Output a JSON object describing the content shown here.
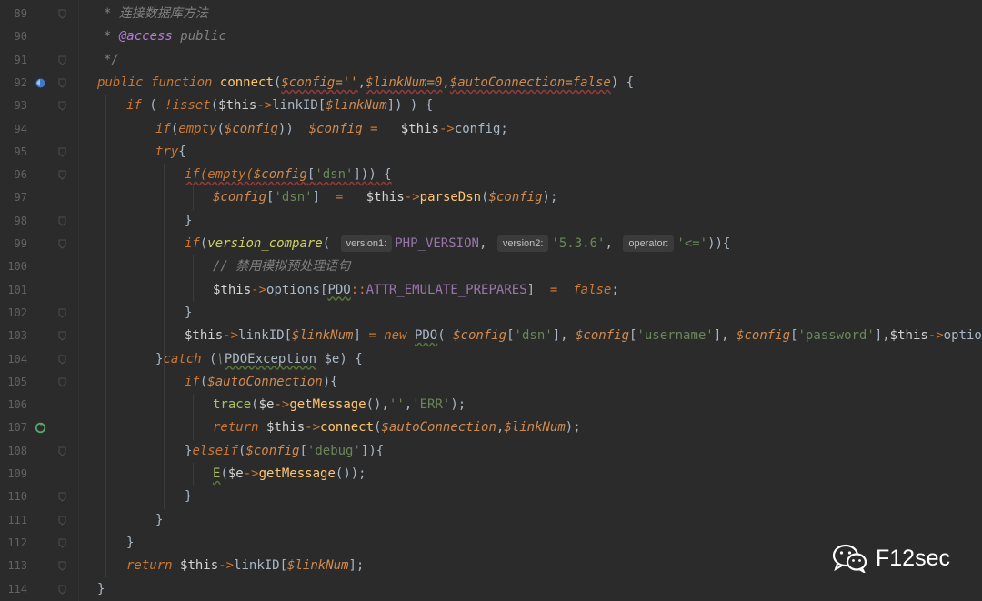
{
  "lines": [
    {
      "num": "89",
      "tokens": [
        {
          "t": "* 连接数据库方法",
          "c": "cmt"
        }
      ]
    },
    {
      "num": "90",
      "tokens": [
        {
          "t": "* ",
          "c": "cmt"
        },
        {
          "t": "@access",
          "c": "tag"
        },
        {
          "t": " public",
          "c": "cmt"
        }
      ]
    },
    {
      "num": "91",
      "tokens": [
        {
          "t": "*/",
          "c": "cmt"
        }
      ]
    },
    {
      "num": "92",
      "tokens": [
        {
          "t": "public",
          "c": "kw"
        },
        {
          "t": " "
        },
        {
          "t": "function",
          "c": "kw"
        },
        {
          "t": " "
        },
        {
          "t": "connect",
          "c": "fn"
        },
        {
          "t": "("
        },
        {
          "t": "$config=''",
          "c": "var wavy"
        },
        {
          "t": ","
        },
        {
          "t": "$linkNum=0",
          "c": "var wavy"
        },
        {
          "t": ","
        },
        {
          "t": "$autoConnection=false",
          "c": "var wavy"
        },
        {
          "t": ") {"
        }
      ]
    },
    {
      "num": "93",
      "tokens": [
        {
          "t": "if",
          "c": "kw"
        },
        {
          "t": " ( "
        },
        {
          "t": "!isset",
          "c": "kw"
        },
        {
          "t": "("
        },
        {
          "t": "$this",
          "c": "this"
        },
        {
          "t": "->",
          "c": "arrow"
        },
        {
          "t": "linkID["
        },
        {
          "t": "$linkNum",
          "c": "var"
        },
        {
          "t": "]) ) {"
        }
      ]
    },
    {
      "num": "94",
      "tokens": [
        {
          "t": "if",
          "c": "kw"
        },
        {
          "t": "("
        },
        {
          "t": "empty",
          "c": "kw"
        },
        {
          "t": "("
        },
        {
          "t": "$config",
          "c": "var"
        },
        {
          "t": "))  "
        },
        {
          "t": "$config",
          "c": "var"
        },
        {
          "t": " = ",
          "c": "arrow"
        },
        {
          "t": "  "
        },
        {
          "t": "$this",
          "c": "this"
        },
        {
          "t": "->",
          "c": "arrow"
        },
        {
          "t": "config;"
        }
      ]
    },
    {
      "num": "95",
      "tokens": [
        {
          "t": "try",
          "c": "kw"
        },
        {
          "t": "{"
        }
      ]
    },
    {
      "num": "96",
      "tokens": [
        {
          "t": "if(empty(",
          "c": "kw wavy"
        },
        {
          "t": "$config",
          "c": "var wavy"
        },
        {
          "t": "[",
          "c": "wavy"
        },
        {
          "t": "'dsn'",
          "c": "str wavy"
        },
        {
          "t": "])) {",
          "c": "wavy"
        }
      ]
    },
    {
      "num": "97",
      "tokens": [
        {
          "t": "$config",
          "c": "var"
        },
        {
          "t": "["
        },
        {
          "t": "'dsn'",
          "c": "str"
        },
        {
          "t": "]  "
        },
        {
          "t": "=",
          "c": "arrow"
        },
        {
          "t": "   "
        },
        {
          "t": "$this",
          "c": "this"
        },
        {
          "t": "->",
          "c": "arrow"
        },
        {
          "t": "parseDsn",
          "c": "fn"
        },
        {
          "t": "("
        },
        {
          "t": "$config",
          "c": "var"
        },
        {
          "t": ");"
        }
      ]
    },
    {
      "num": "98",
      "tokens": [
        {
          "t": "}"
        }
      ]
    },
    {
      "num": "99",
      "tokens": [
        {
          "t": "if",
          "c": "kw"
        },
        {
          "t": "("
        },
        {
          "t": "version_compare",
          "c": "fnc"
        },
        {
          "t": "( "
        },
        {
          "t": "version1:",
          "c": "hint"
        },
        {
          "t": "PHP_VERSION",
          "c": "const"
        },
        {
          "t": ", "
        },
        {
          "t": "version2:",
          "c": "hint"
        },
        {
          "t": "'5.3.6'",
          "c": "str"
        },
        {
          "t": ", "
        },
        {
          "t": "operator:",
          "c": "hint"
        },
        {
          "t": "'<='",
          "c": "str"
        },
        {
          "t": ")){"
        }
      ]
    },
    {
      "num": "100",
      "tokens": [
        {
          "t": "// 禁用模拟预处理语句",
          "c": "cmt"
        }
      ]
    },
    {
      "num": "101",
      "tokens": [
        {
          "t": "$this",
          "c": "this"
        },
        {
          "t": "->",
          "c": "arrow"
        },
        {
          "t": "options["
        },
        {
          "t": "PDO",
          "c": "cls wavyg"
        },
        {
          "t": "::",
          "c": "arrow"
        },
        {
          "t": "ATTR_EMULATE_PREPARES",
          "c": "const"
        },
        {
          "t": "]  "
        },
        {
          "t": "=",
          "c": "arrow"
        },
        {
          "t": "  "
        },
        {
          "t": "false",
          "c": "kw"
        },
        {
          "t": ";"
        }
      ]
    },
    {
      "num": "102",
      "tokens": [
        {
          "t": "}"
        }
      ]
    },
    {
      "num": "103",
      "tokens": [
        {
          "t": "$this",
          "c": "this"
        },
        {
          "t": "->",
          "c": "arrow"
        },
        {
          "t": "linkID["
        },
        {
          "t": "$linkNum",
          "c": "var"
        },
        {
          "t": "] "
        },
        {
          "t": "=",
          "c": "arrow"
        },
        {
          "t": " "
        },
        {
          "t": "new",
          "c": "kw"
        },
        {
          "t": " "
        },
        {
          "t": "PDO",
          "c": "cls wavyg"
        },
        {
          "t": "( "
        },
        {
          "t": "$config",
          "c": "var"
        },
        {
          "t": "["
        },
        {
          "t": "'dsn'",
          "c": "str"
        },
        {
          "t": "], "
        },
        {
          "t": "$config",
          "c": "var"
        },
        {
          "t": "["
        },
        {
          "t": "'username'",
          "c": "str"
        },
        {
          "t": "], "
        },
        {
          "t": "$config",
          "c": "var"
        },
        {
          "t": "["
        },
        {
          "t": "'password'",
          "c": "str"
        },
        {
          "t": "],"
        },
        {
          "t": "$this",
          "c": "this"
        },
        {
          "t": "->",
          "c": "arrow"
        },
        {
          "t": "options);"
        }
      ]
    },
    {
      "num": "104",
      "tokens": [
        {
          "t": "}"
        },
        {
          "t": "catch",
          "c": "kw"
        },
        {
          "t": " ("
        },
        {
          "t": "\\",
          "c": "cmt"
        },
        {
          "t": "PDOException",
          "c": "cls wavyg"
        },
        {
          "t": " $e) {"
        }
      ]
    },
    {
      "num": "105",
      "tokens": [
        {
          "t": "if",
          "c": "kw"
        },
        {
          "t": "("
        },
        {
          "t": "$autoConnection",
          "c": "var"
        },
        {
          "t": "){"
        }
      ]
    },
    {
      "num": "106",
      "tokens": [
        {
          "t": "trace",
          "c": "green"
        },
        {
          "t": "("
        },
        {
          "t": "$e",
          "c": "this"
        },
        {
          "t": "->",
          "c": "arrow"
        },
        {
          "t": "getMessage",
          "c": "fn"
        },
        {
          "t": "(),"
        },
        {
          "t": "''",
          "c": "str"
        },
        {
          "t": ","
        },
        {
          "t": "'ERR'",
          "c": "str"
        },
        {
          "t": ");"
        }
      ]
    },
    {
      "num": "107",
      "tokens": [
        {
          "t": "return",
          "c": "kw"
        },
        {
          "t": " "
        },
        {
          "t": "$this",
          "c": "this"
        },
        {
          "t": "->",
          "c": "arrow"
        },
        {
          "t": "connect",
          "c": "fn"
        },
        {
          "t": "("
        },
        {
          "t": "$autoConnection",
          "c": "var"
        },
        {
          "t": ","
        },
        {
          "t": "$linkNum",
          "c": "var"
        },
        {
          "t": ");"
        }
      ]
    },
    {
      "num": "108",
      "tokens": [
        {
          "t": "}"
        },
        {
          "t": "elseif",
          "c": "kw"
        },
        {
          "t": "("
        },
        {
          "t": "$config",
          "c": "var"
        },
        {
          "t": "["
        },
        {
          "t": "'debug'",
          "c": "str"
        },
        {
          "t": "]){"
        }
      ]
    },
    {
      "num": "109",
      "tokens": [
        {
          "t": "E",
          "c": "green wavyg"
        },
        {
          "t": "("
        },
        {
          "t": "$e",
          "c": "this"
        },
        {
          "t": "->",
          "c": "arrow"
        },
        {
          "t": "getMessage",
          "c": "fn"
        },
        {
          "t": "());"
        }
      ]
    },
    {
      "num": "110",
      "tokens": [
        {
          "t": "}"
        }
      ]
    },
    {
      "num": "111",
      "tokens": [
        {
          "t": "}"
        }
      ]
    },
    {
      "num": "112",
      "tokens": [
        {
          "t": "}"
        }
      ]
    },
    {
      "num": "113",
      "tokens": [
        {
          "t": "return",
          "c": "kw"
        },
        {
          "t": " "
        },
        {
          "t": "$this",
          "c": "this"
        },
        {
          "t": "->",
          "c": "arrow"
        },
        {
          "t": "linkID["
        },
        {
          "t": "$linkNum",
          "c": "var"
        },
        {
          "t": "];"
        }
      ]
    },
    {
      "num": "114",
      "tokens": [
        {
          "t": "}"
        }
      ]
    }
  ],
  "gutter_icons": {
    "92": "implements-method-icon",
    "107": "recursive-call-icon"
  },
  "watermark": {
    "text": "F12sec",
    "icon": "wechat-icon"
  },
  "colors": {
    "background": "#2b2b2b",
    "keyword": "#cc7832",
    "string": "#6a8759",
    "variable": "#d08a4f",
    "function": "#ffc66d",
    "comment": "#808080"
  }
}
